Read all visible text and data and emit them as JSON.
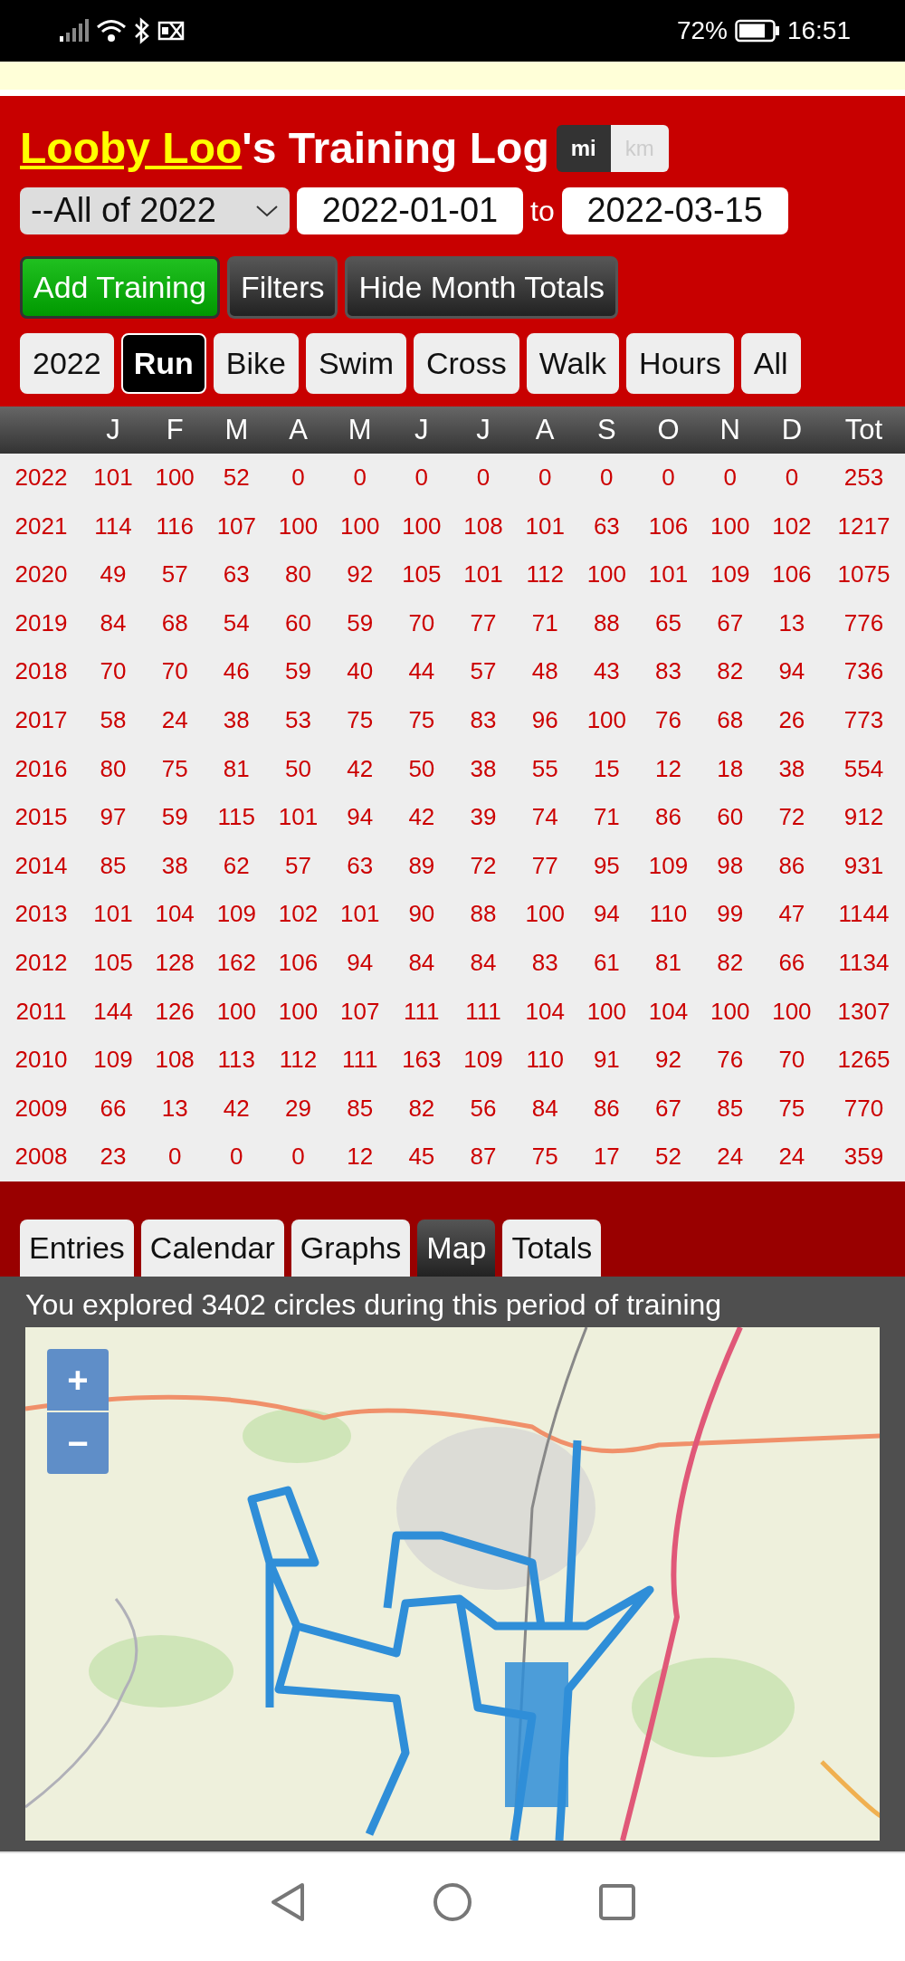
{
  "status_bar": {
    "battery": "72%",
    "time": "16:51"
  },
  "header": {
    "title_link": "Looby Loo",
    "title_rest": "'s Training Log",
    "units": [
      {
        "label": "mi",
        "selected": true
      },
      {
        "label": "km",
        "selected": false
      }
    ]
  },
  "period": {
    "select": "--All of 2022",
    "from": "2022-01-01",
    "to_label": "to",
    "to": "2022-03-15"
  },
  "actions": [
    {
      "label": "Add Training",
      "kind": "primary"
    },
    {
      "label": "Filters",
      "kind": "dark"
    },
    {
      "label": "Hide Month Totals",
      "kind": "dark"
    }
  ],
  "filters": [
    {
      "label": "2022",
      "selected": false
    },
    {
      "label": "Run",
      "selected": true
    },
    {
      "label": "Bike",
      "selected": false
    },
    {
      "label": "Swim",
      "selected": false
    },
    {
      "label": "Cross",
      "selected": false
    },
    {
      "label": "Walk",
      "selected": false
    },
    {
      "label": "Hours",
      "selected": false
    },
    {
      "label": "All",
      "selected": false
    }
  ],
  "table": {
    "columns": [
      "",
      "J",
      "F",
      "M",
      "A",
      "M",
      "J",
      "J",
      "A",
      "S",
      "O",
      "N",
      "D",
      "Tot"
    ],
    "rows": [
      [
        "2022",
        "101",
        "100",
        "52",
        "0",
        "0",
        "0",
        "0",
        "0",
        "0",
        "0",
        "0",
        "0",
        "253"
      ],
      [
        "2021",
        "114",
        "116",
        "107",
        "100",
        "100",
        "100",
        "108",
        "101",
        "63",
        "106",
        "100",
        "102",
        "1217"
      ],
      [
        "2020",
        "49",
        "57",
        "63",
        "80",
        "92",
        "105",
        "101",
        "112",
        "100",
        "101",
        "109",
        "106",
        "1075"
      ],
      [
        "2019",
        "84",
        "68",
        "54",
        "60",
        "59",
        "70",
        "77",
        "71",
        "88",
        "65",
        "67",
        "13",
        "776"
      ],
      [
        "2018",
        "70",
        "70",
        "46",
        "59",
        "40",
        "44",
        "57",
        "48",
        "43",
        "83",
        "82",
        "94",
        "736"
      ],
      [
        "2017",
        "58",
        "24",
        "38",
        "53",
        "75",
        "75",
        "83",
        "96",
        "100",
        "76",
        "68",
        "26",
        "773"
      ],
      [
        "2016",
        "80",
        "75",
        "81",
        "50",
        "42",
        "50",
        "38",
        "55",
        "15",
        "12",
        "18",
        "38",
        "554"
      ],
      [
        "2015",
        "97",
        "59",
        "115",
        "101",
        "94",
        "42",
        "39",
        "74",
        "71",
        "86",
        "60",
        "72",
        "912"
      ],
      [
        "2014",
        "85",
        "38",
        "62",
        "57",
        "63",
        "89",
        "72",
        "77",
        "95",
        "109",
        "98",
        "86",
        "931"
      ],
      [
        "2013",
        "101",
        "104",
        "109",
        "102",
        "101",
        "90",
        "88",
        "100",
        "94",
        "110",
        "99",
        "47",
        "1144"
      ],
      [
        "2012",
        "105",
        "128",
        "162",
        "106",
        "94",
        "84",
        "84",
        "83",
        "61",
        "81",
        "82",
        "66",
        "1134"
      ],
      [
        "2011",
        "144",
        "126",
        "100",
        "100",
        "107",
        "111",
        "111",
        "104",
        "100",
        "104",
        "100",
        "100",
        "1307"
      ],
      [
        "2010",
        "109",
        "108",
        "113",
        "112",
        "111",
        "163",
        "109",
        "110",
        "91",
        "92",
        "76",
        "70",
        "1265"
      ],
      [
        "2009",
        "66",
        "13",
        "42",
        "29",
        "85",
        "82",
        "56",
        "84",
        "86",
        "67",
        "85",
        "75",
        "770"
      ],
      [
        "2008",
        "23",
        "0",
        "0",
        "0",
        "12",
        "45",
        "87",
        "75",
        "17",
        "52",
        "24",
        "24",
        "359"
      ]
    ]
  },
  "tabs": [
    {
      "label": "Entries",
      "selected": false
    },
    {
      "label": "Calendar",
      "selected": false
    },
    {
      "label": "Graphs",
      "selected": false
    },
    {
      "label": "Map",
      "selected": true
    },
    {
      "label": "Totals",
      "selected": false
    }
  ],
  "map": {
    "summary": "You explored 3402 circles during this period of training",
    "kind": "picture",
    "zoom_in": "+",
    "zoom_out": "−"
  }
}
